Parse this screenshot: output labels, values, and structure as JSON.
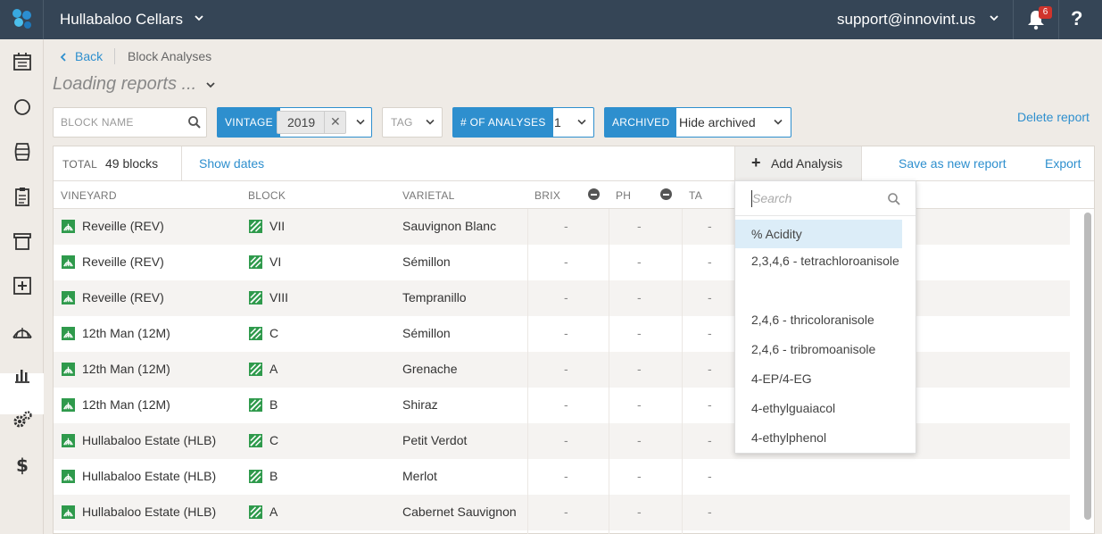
{
  "header": {
    "org_name": "Hullabaloo Cellars",
    "user_email": "support@innovint.us",
    "notification_count": "6",
    "help_label": "?"
  },
  "sidebar": {
    "items": [
      {
        "icon": "calendar-icon"
      },
      {
        "icon": "circle-icon"
      },
      {
        "icon": "barrel-icon"
      },
      {
        "icon": "clipboard-icon"
      },
      {
        "icon": "archive-icon"
      },
      {
        "icon": "plus-square-icon"
      },
      {
        "icon": "vineyard-icon"
      },
      {
        "icon": "bar-chart-icon",
        "active": true
      },
      {
        "icon": "gears-icon"
      },
      {
        "icon": "dollar-icon"
      }
    ]
  },
  "breadcrumb": {
    "back_label": "Back",
    "current": "Block Analyses"
  },
  "page": {
    "title": "Loading reports ..."
  },
  "filters": {
    "block_name_placeholder": "BLOCK NAME",
    "vintage_label": "VINTAGE",
    "vintage_value": "2019",
    "tag_placeholder": "TAG",
    "analyses_label": "# OF ANALYSES",
    "analyses_value": "1",
    "archived_label": "ARCHIVED",
    "archived_value": "Hide archived",
    "delete_report": "Delete report"
  },
  "toolbar": {
    "total_label": "TOTAL",
    "total_value": "49 blocks",
    "show_dates": "Show dates",
    "add_analysis": "Add Analysis",
    "save_as_new": "Save as new report",
    "export": "Export"
  },
  "table": {
    "columns": [
      "VINEYARD",
      "BLOCK",
      "VARIETAL",
      "BRIX",
      "PH",
      "TA"
    ],
    "rows": [
      {
        "vineyard": "Reveille (REV)",
        "block": "VII",
        "varietal": "Sauvignon Blanc",
        "brix": "-",
        "ph": "-",
        "ta": "-"
      },
      {
        "vineyard": "Reveille (REV)",
        "block": "VI",
        "varietal": "Sémillon",
        "brix": "-",
        "ph": "-",
        "ta": "-"
      },
      {
        "vineyard": "Reveille (REV)",
        "block": "VIII",
        "varietal": "Tempranillo",
        "brix": "-",
        "ph": "-",
        "ta": "-"
      },
      {
        "vineyard": "12th Man (12M)",
        "block": "C",
        "varietal": "Sémillon",
        "brix": "-",
        "ph": "-",
        "ta": "-"
      },
      {
        "vineyard": "12th Man (12M)",
        "block": "A",
        "varietal": "Grenache",
        "brix": "-",
        "ph": "-",
        "ta": "-"
      },
      {
        "vineyard": "12th Man (12M)",
        "block": "B",
        "varietal": "Shiraz",
        "brix": "-",
        "ph": "-",
        "ta": "-"
      },
      {
        "vineyard": "Hullabaloo Estate (HLB)",
        "block": "C",
        "varietal": "Petit Verdot",
        "brix": "-",
        "ph": "-",
        "ta": "-"
      },
      {
        "vineyard": "Hullabaloo Estate (HLB)",
        "block": "B",
        "varietal": "Merlot",
        "brix": "-",
        "ph": "-",
        "ta": "-"
      },
      {
        "vineyard": "Hullabaloo Estate (HLB)",
        "block": "A",
        "varietal": "Cabernet Sauvignon",
        "brix": "-",
        "ph": "-",
        "ta": "-"
      }
    ]
  },
  "dropdown": {
    "search_placeholder": "Search",
    "items": [
      {
        "label": "% Acidity",
        "highlighted": true
      },
      {
        "label": "2,3,4,6 - tetrachloroanisole"
      },
      {
        "label": "2,4,6 - thricoloranisole"
      },
      {
        "label": "2,4,6 - tribromoanisole"
      },
      {
        "label": "4-EP/4-EG"
      },
      {
        "label": "4-ethylguaiacol"
      },
      {
        "label": "4-ethylphenol"
      }
    ]
  },
  "colors": {
    "topbar": "#354556",
    "accent_blue": "#2e8fce",
    "vineyard_green": "#2f9a4c",
    "badge_red": "#d0342c"
  }
}
